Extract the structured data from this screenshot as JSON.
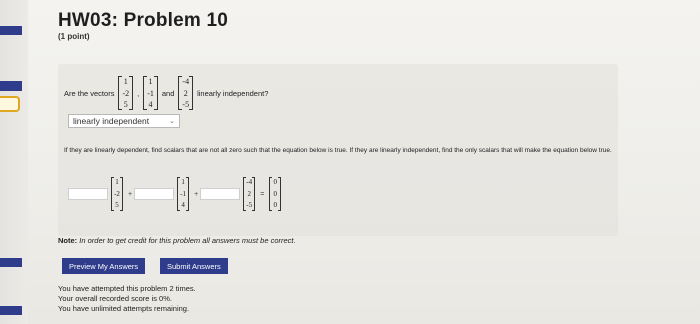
{
  "page": {
    "title": "HW03: Problem 10",
    "points": "(1 point)"
  },
  "question": {
    "prefix": "Are the vectors",
    "vectors": [
      [
        "1",
        "-2",
        "5"
      ],
      [
        "1",
        "-1",
        "4"
      ],
      [
        "-4",
        "2",
        "-5"
      ]
    ],
    "sep1": ",",
    "sep2": "and",
    "suffix": "linearly independent?"
  },
  "answer_select": {
    "value": "linearly independent",
    "icon": "chevron-down-icon"
  },
  "instructions": "If they are linearly dependent, find scalars that are not all zero such that the equation below is true. If they are linearly independent, find the only scalars that will make the equation below true.",
  "equation": {
    "vectors": [
      [
        "1",
        "-2",
        "5"
      ],
      [
        "1",
        "-1",
        "4"
      ],
      [
        "-4",
        "2",
        "-5"
      ]
    ],
    "zero_vector": [
      "0",
      "0",
      "0"
    ],
    "plus": "+",
    "equals": "="
  },
  "note": {
    "label": "Note:",
    "text": "In order to get credit for this problem all answers must be correct."
  },
  "buttons": {
    "preview": "Preview My Answers",
    "submit": "Submit Answers"
  },
  "status": {
    "attempts": "You have attempted this problem 2 times.",
    "score": "Your overall recorded score is 0%.",
    "remaining": "You have unlimited attempts remaining."
  },
  "colors": {
    "button": "#2f3c8c",
    "strip_accent": "#e0a820"
  }
}
